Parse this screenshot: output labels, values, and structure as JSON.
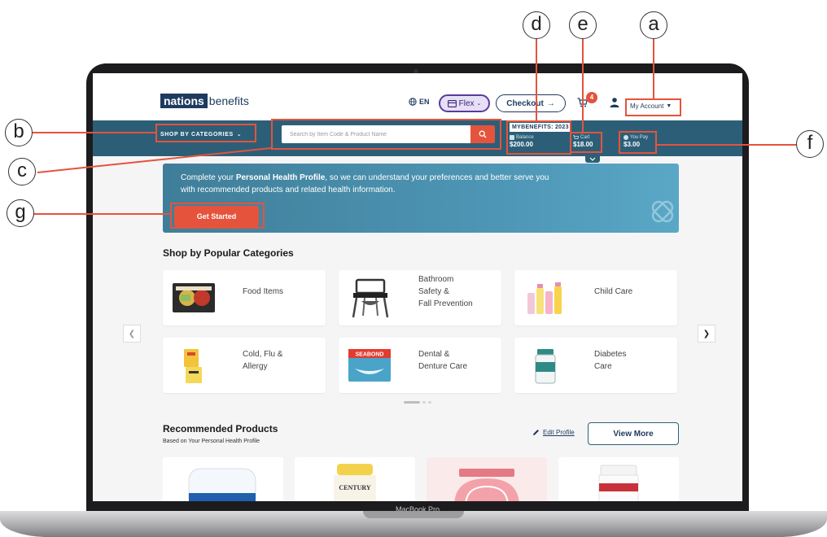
{
  "header": {
    "logo_primary": "nations",
    "logo_secondary": "benefits",
    "language": "EN",
    "flex_label": "Flex",
    "checkout_label": "Checkout",
    "cart_count": "4",
    "account_label": "My Account"
  },
  "navbar": {
    "shop_by_categories": "SHOP BY CATEGORIES",
    "search_placeholder": "Search by Item Code & Product Name",
    "benefits_label": "MYBENEFITS: 2023",
    "balance_label": "Balance",
    "balance_value": "$200.00",
    "cart_label": "Cart",
    "cart_value": "$18.00",
    "you_pay_label": "You Pay",
    "you_pay_value": "$3.00"
  },
  "banner": {
    "text_before": "Complete your ",
    "text_bold": "Personal Health Profile",
    "text_after": ", so we can understand your preferences and better serve you with recommended products and related health information.",
    "button": "Get Started"
  },
  "popular": {
    "title": "Shop by Popular Categories",
    "categories": [
      {
        "line1": "Food Items",
        "line2": "",
        "line3": ""
      },
      {
        "line1": "Bathroom",
        "line2": "Safety &",
        "line3": "Fall Prevention"
      },
      {
        "line1": "Child Care",
        "line2": "",
        "line3": ""
      },
      {
        "line1": "Cold, Flu &",
        "line2": "Allergy",
        "line3": ""
      },
      {
        "line1": "Dental &",
        "line2": "Denture Care",
        "line3": ""
      },
      {
        "line1": "Diabetes",
        "line2": "Care",
        "line3": ""
      }
    ],
    "dental_product_text": "SEABOND"
  },
  "recommended": {
    "title": "Recommended Products",
    "subtitle": "Based on Your Personal Health Profile",
    "edit_profile": "Edit Profile",
    "view_more": "View More",
    "product_text": "CENTURY"
  },
  "device": {
    "label": "MacBook Pro"
  },
  "callouts": [
    "a",
    "b",
    "c",
    "d",
    "e",
    "f",
    "g"
  ],
  "colors": {
    "navbar": "#2c5f77",
    "accent": "#e5533d",
    "brand_navy": "#1e3a5f",
    "flex_purple": "#5b3b9a"
  }
}
